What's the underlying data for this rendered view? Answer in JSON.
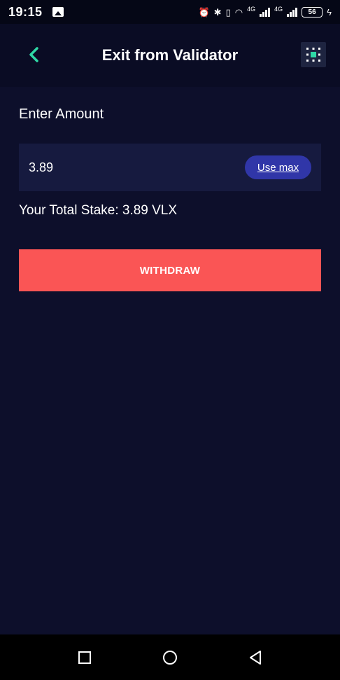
{
  "status_bar": {
    "time": "19:15",
    "network_1": "4G",
    "network_2": "4G",
    "battery": "56"
  },
  "header": {
    "title": "Exit from Validator",
    "back_icon": "chevron-left-icon",
    "menu_icon": "grid-dots-icon"
  },
  "form": {
    "label": "Enter Amount",
    "amount_value": "3.89",
    "use_max_label": "Use max",
    "total_stake": "Your Total Stake: 3.89 VLX",
    "withdraw_label": "WITHDRAW"
  },
  "colors": {
    "background": "#0d0f2b",
    "accent": "#2fd9a6",
    "withdraw": "#fa5555",
    "use_max": "#3036a8"
  },
  "nav": {
    "recent_icon": "square-icon",
    "home_icon": "circle-icon",
    "back_icon": "triangle-back-icon"
  }
}
